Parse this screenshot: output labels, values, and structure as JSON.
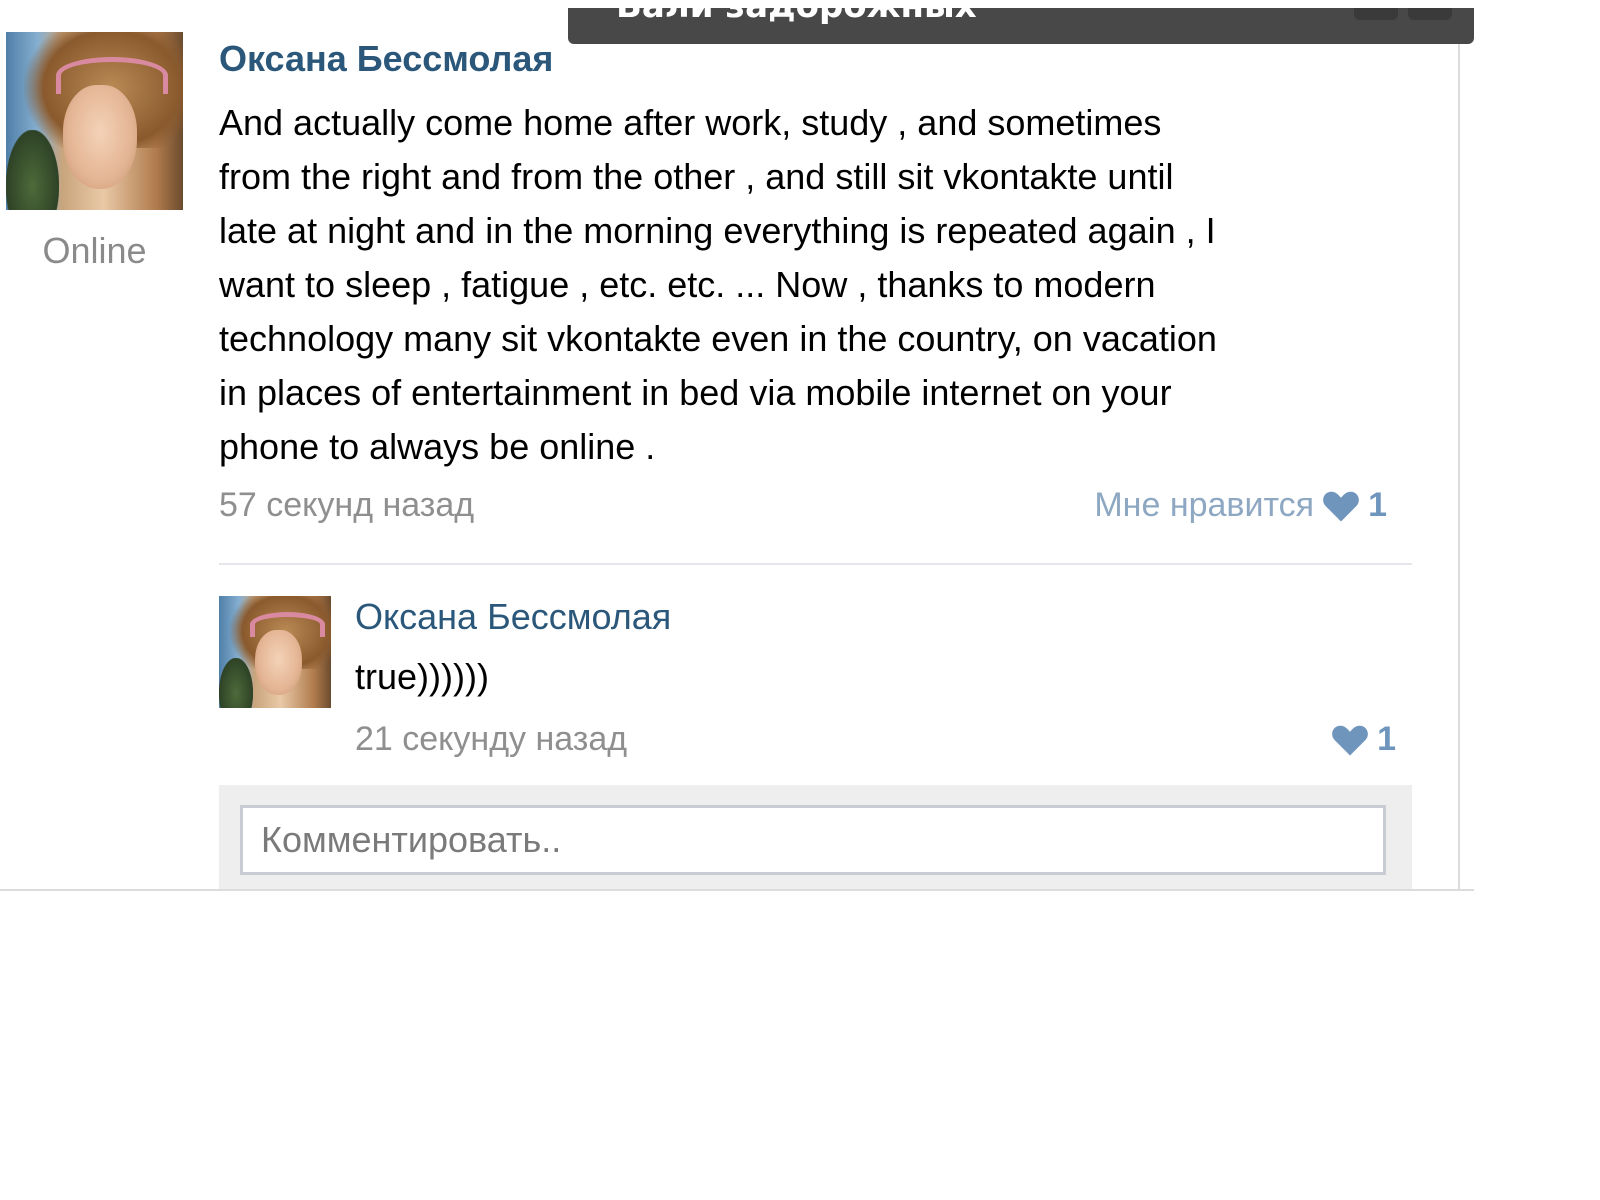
{
  "tooltip": {
    "text": "Бали задорожных"
  },
  "post": {
    "avatar_icon": "user-photo",
    "online_label": "Online",
    "author": "Оксана Бессмолая",
    "text_lines": [
      "And actually come home after work, study , and sometimes",
      "from the right and from the other , and still sit vkontakte until",
      "late at night and in the morning everything is repeated again , I",
      "want to sleep , fatigue , etc. etc. ... Now , thanks to modern",
      "technology many sit vkontakte even in the country, on vacation",
      "in places of entertainment in bed via mobile internet on your",
      "phone to always be online ."
    ],
    "time": "57 секунд назад",
    "like_label": "Мне нравится",
    "like_icon": "heart-icon",
    "like_count": "1"
  },
  "reply": {
    "author": "Оксана Бессмолая",
    "text": "true))))))",
    "time": "21 секунду назад",
    "like_icon": "heart-icon",
    "like_count": "1"
  },
  "comment": {
    "placeholder": "Комментировать.."
  },
  "colors": {
    "link": "#2b587a",
    "heart": "#6f95bd",
    "muted": "#8f8f8f",
    "tooltip_bg": "#484848"
  }
}
